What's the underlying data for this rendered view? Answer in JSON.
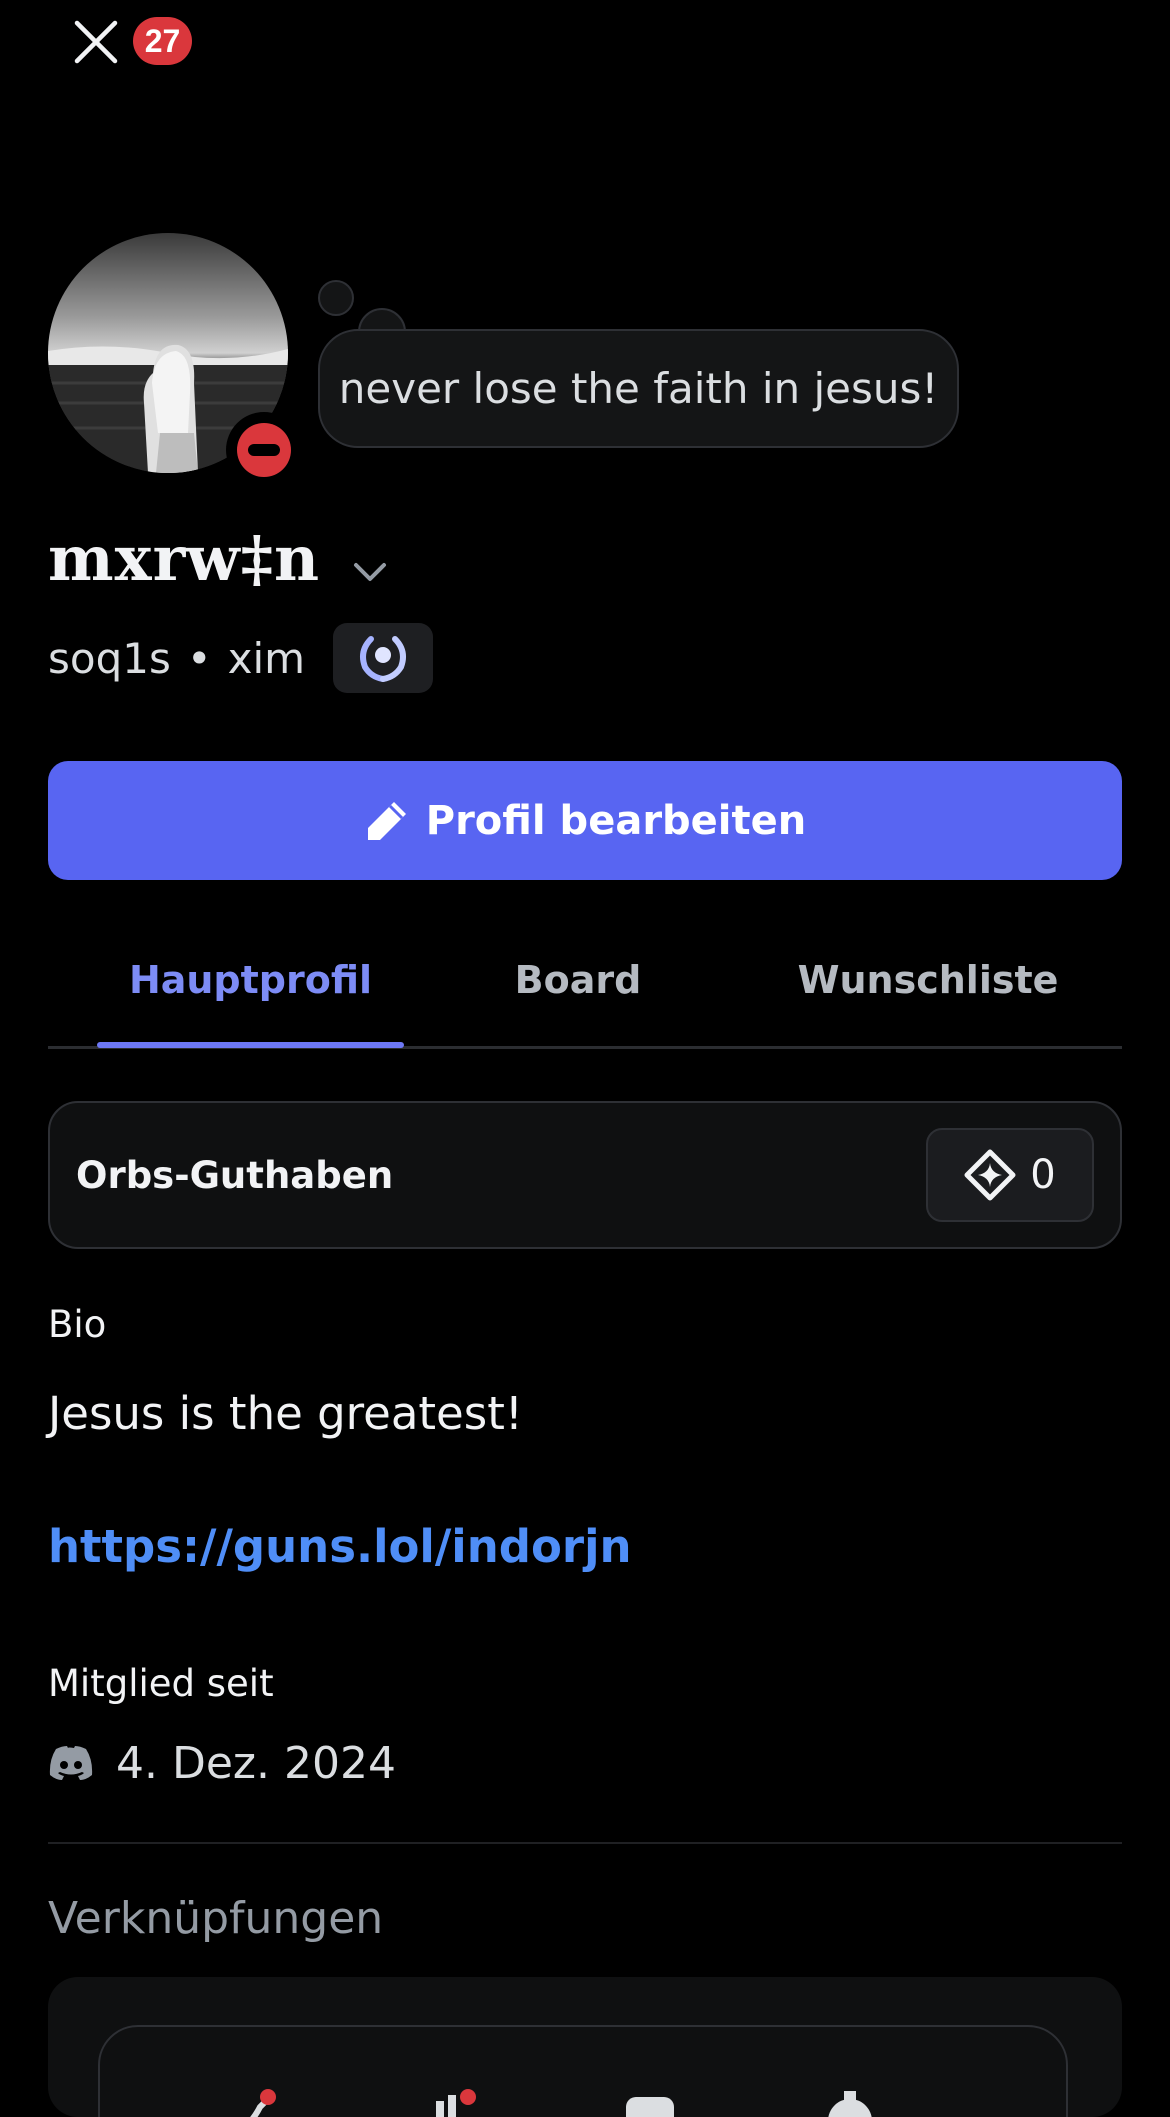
{
  "header": {
    "close_icon": "close-icon",
    "notification_count": "27",
    "badge_color": "#da373c"
  },
  "profile": {
    "status": "dnd",
    "custom_status": "never lose the faith in jesus!",
    "display_name": "mxrw‡n",
    "username": "soq1s",
    "pronouns": "xim",
    "separator": "•",
    "badge_icon": "nitro-laurel-badge-icon"
  },
  "actions": {
    "edit_label": "Profil bearbeiten",
    "edit_icon": "pencil-icon",
    "accent": "#5865f2"
  },
  "tabs": [
    {
      "label": "Hauptprofil",
      "active": true
    },
    {
      "label": "Board",
      "active": false
    },
    {
      "label": "Wunschliste",
      "active": false
    }
  ],
  "orbs": {
    "label": "Orbs-Guthaben",
    "value": "0",
    "icon": "orb-icon"
  },
  "bio": {
    "heading": "Bio",
    "text": "Jesus is the greatest!",
    "link": "https://guns.lol/indorjn",
    "link_color": "#4f8ef7"
  },
  "member_since": {
    "heading": "Mitglied seit",
    "date": "4. Dez. 2024",
    "icon": "discord-icon"
  },
  "connections": {
    "heading": "Verknüpfungen"
  }
}
